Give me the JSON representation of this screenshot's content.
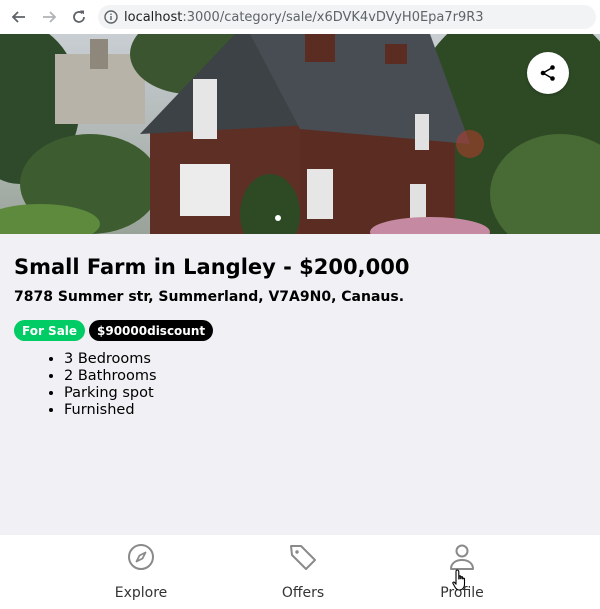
{
  "browser": {
    "url_host": "localhost",
    "url_path": ":3000/category/sale/x6DVK4vDVyH0Epa7r9R3"
  },
  "listing": {
    "title": "Small Farm in Langley - $200,000",
    "address": "7878 Summer str, Summerland, V7A9N0, Canaus.",
    "sale_badge": "For Sale",
    "discount_badge": "$90000discount",
    "features": [
      "3 Bedrooms",
      "2 Bathrooms",
      "Parking spot",
      "Furnished"
    ],
    "hero_image": "photo of a brick house with green gardens",
    "share_icon": "share-icon"
  },
  "colors": {
    "sale_badge": "#00cc66",
    "discount_badge": "#000000",
    "page_background": "#f1f1f5"
  },
  "bottom_nav": {
    "items": [
      {
        "label": "Explore",
        "icon": "compass-icon"
      },
      {
        "label": "Offers",
        "icon": "tag-icon"
      },
      {
        "label": "Profile",
        "icon": "person-icon"
      }
    ]
  }
}
